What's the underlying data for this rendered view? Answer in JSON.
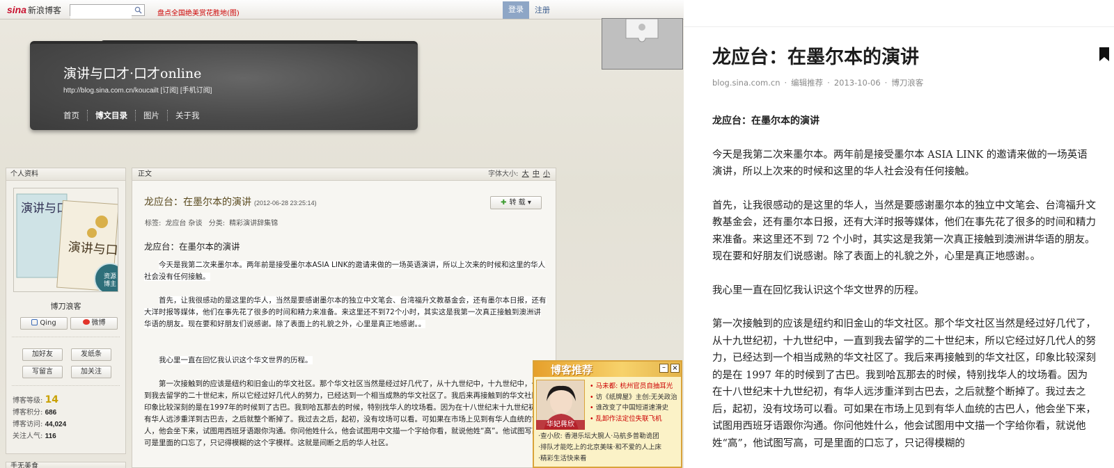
{
  "topbar": {
    "logo_text": "新浪博客",
    "logo_mark": "sina",
    "search_placeholder": "",
    "promo_link": "盘点全国绝美赏花胜地(图)",
    "login_label": "登录",
    "register_label": "注册"
  },
  "header": {
    "blog_title": "演讲与口才·口才online",
    "blog_url": "http://blog.sina.com.cn/koucailt  [订阅] [手机订阅]",
    "nav": [
      "首页",
      "博文目录",
      "图片",
      "关于我"
    ]
  },
  "sidebar": {
    "head": "个人资料",
    "badge_text": "资源\n博主",
    "user_name": "博刀浪客",
    "qing_label": "Qing",
    "weibo_label": "微博",
    "add_friend": "加好友",
    "send_note": "发纸条",
    "leave_msg": "写留言",
    "follow": "加关注",
    "stats": [
      {
        "label": "博客等级:",
        "value": "14"
      },
      {
        "label": "博客积分:",
        "value": "686"
      },
      {
        "label": "博客访问:",
        "value": "44,024"
      },
      {
        "label": "关注人气:",
        "value": "116"
      }
    ],
    "next_head": "手无美食"
  },
  "content": {
    "head": "正文",
    "font_size_label": "字体大小:",
    "font_sizes": [
      "大",
      "中",
      "小"
    ],
    "title": "龙应台：在墨尔本的演讲",
    "date": "(2012-06-28 23:25:14)",
    "repost_label": "转 载",
    "tags_label": "标签:",
    "tags": "龙应台  杂谈",
    "category_label": "分类:",
    "category": "精彩演讲辞集锦",
    "subtitle": "龙应台：在墨尔本的演讲",
    "p1": "今天是我第二次来墨尔本。两年前是接受墨尔本ASIA LINK的邀请来做的一场英语演讲，所以上次来的时候和这里的华人社会没有任何接触。",
    "p2": "首先，让我很感动的是这里的华人，当然是要感谢墨尔本的独立中文笔会、台湾福升文教基金会，还有墨尔本日报，还有大洋时报等媒体，他们在事先花了很多的时间和精力来准备。来这里还不到72个小时，其实这是我第一次真正接触到澳洲讲华语的朋友。现在要和好朋友们说感谢。除了表面上的礼貌之外，心里是真正地感谢。。",
    "p3": "我心里一直在回忆我认识这个华文世界的历程。",
    "p4": "第一次接触到的应该是纽约和旧金山的华文社区。那个华文社区当然是经过好几代了，从十九世纪中，十九世纪中，一直到我去留学的二十世纪末，所以它经过好几代人的努力，已经达到一个相当成熟的华文社区了。我后来再接触到的华文社区，印象比较深刻的是在1997年的时候到了古巴。我到哈瓦那去的时候，特别找华人的坟场看。因为在十八世纪末十九世纪初，有华人远涉重洋到古巴去，之后就整个断掉了。我过去之后，起初，没有坟场可以看。可如果在市场上见到有华人血统的古巴人，他会坐下来，试图用西班牙语跟你沟通。你问他姓什么，他会试图用中文描一个字给你看，就说他姓“高”。他试图写高，可是里面的口忘了，只记得模糊的这个字模样。这就是间断之后的华人社区。"
  },
  "recommend": {
    "title": "博客推荐",
    "min_label": "–",
    "close_label": "×",
    "photo_caption": "华妃蒋欣",
    "links": [
      {
        "text": "马未都: 杭州官员自抽耳光",
        "red": true
      },
      {
        "text": "访《纸牌屋》主创:无关政治",
        "red": false
      },
      {
        "text": "谁改变了中国短道速滑史",
        "red": false
      },
      {
        "text": "乱卸作法定位失联飞机",
        "red": true
      }
    ],
    "bottom": [
      "·查小欣: 香港乐坛大腕人·马航多普勒诡团",
      "·排队才能吃上的北京美味·和不爱的人上床",
      "·精彩生活快来看"
    ]
  },
  "reader": {
    "title": "龙应台：在墨尔本的演讲",
    "meta": [
      "blog.sina.com.cn",
      "编辑推荐",
      "2013-10-06",
      "博刀浪客"
    ],
    "lead": "龙应台：在墨尔本的演讲",
    "p1": "今天是我第二次来墨尔本。两年前是接受墨尔本 ASIA LINK 的邀请来做的一场英语演讲，所以上次来的时候和这里的华人社会没有任何接触。",
    "p2": "首先，让我很感动的是这里的华人，当然是要感谢墨尔本的独立中文笔会、台湾福升文教基金会，还有墨尔本日报，还有大洋时报等媒体，他们在事先花了很多的时间和精力来准备。来这里还不到 72 个小时，其实这是我第一次真正接触到澳洲讲华语的朋友。现在要和好朋友们说感谢。除了表面上的礼貌之外，心里是真正地感谢。。",
    "p3": "我心里一直在回忆我认识这个华文世界的历程。",
    "p4": "第一次接触到的应该是纽约和旧金山的华文社区。那个华文社区当然是经过好几代了，从十九世纪初，十九世纪中，一直到我去留学的二十世纪末，所以它经过好几代人的努力，已经达到一个相当成熟的华文社区了。我后来再接触到的华文社区，印象比较深刻的是在 1997 年的时候到了古巴。我到哈瓦那去的时候，特别找华人的坟场看。因为在十八世纪末十九世纪初，有华人远涉重洋到古巴去，之后就整个断掉了。我过去之后，起初，没有坟场可以看。可如果在市场上见到有华人血统的古巴人，他会坐下来，试图用西班牙语跟你沟通。你问他姓什么，他会试图用中文描一个字给你看，就说他姓“高”，他试图写高，可是里面的口忘了，只记得模糊的"
  }
}
